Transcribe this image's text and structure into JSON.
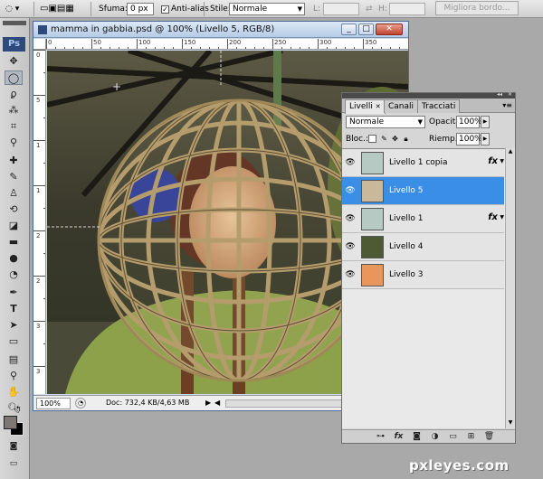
{
  "options_bar": {
    "feather_label": "Sfuma:",
    "feather_value": "0 px",
    "antialias_label": "Anti-alias",
    "antialias_checked": true,
    "style_label": "Stile:",
    "style_value": "Normale",
    "width_label": "L:",
    "height_label": "H:",
    "refine_edge_label": "Migliora bordo..."
  },
  "tools": {
    "logo": "Ps",
    "items": [
      "move-tool",
      "marquee-tool",
      "lasso-tool",
      "magic-wand-tool",
      "crop-tool",
      "eyedropper-tool",
      "healing-tool",
      "brush-tool",
      "clone-stamp-tool",
      "history-brush-tool",
      "eraser-tool",
      "gradient-tool",
      "blur-tool",
      "dodge-tool",
      "pen-tool",
      "type-tool",
      "path-selection-tool",
      "shape-tool",
      "notes-tool",
      "eyedropper-3d-tool",
      "hand-tool",
      "zoom-tool"
    ],
    "foreground_color": "#7f7774",
    "background_color": "#000000"
  },
  "document": {
    "title": "mamma in gabbia.psd @ 100% (Livello 5, RGB/8)",
    "zoom": "100%",
    "info": "Doc: 732,4 KB/4,63 MB",
    "ruler_top": [
      "0",
      "50",
      "100",
      "150",
      "200",
      "250",
      "300",
      "350"
    ],
    "ruler_left": [
      "0",
      "5",
      "1",
      "1",
      "2",
      "2",
      "3",
      "3"
    ]
  },
  "layers_panel": {
    "tabs": [
      "Livelli",
      "Canali",
      "Tracciati"
    ],
    "active_tab": "Livelli",
    "blend_mode": "Normale",
    "opacity_label": "Opacità:",
    "opacity_value": "100%",
    "lock_label": "Bloc.:",
    "fill_label": "Riemp.:",
    "fill_value": "100%",
    "layers": [
      {
        "name": "Livello 1 copia",
        "fx": "fx",
        "active": false,
        "thumb": "#b7c9c3"
      },
      {
        "name": "Livello 5",
        "fx": "",
        "active": true,
        "thumb": "#c9b89a"
      },
      {
        "name": "Livello 1",
        "fx": "fx",
        "active": false,
        "thumb": "#b7c9c3"
      },
      {
        "name": "Livello 4",
        "fx": "",
        "active": false,
        "thumb": "#4e5a34"
      },
      {
        "name": "Livello 3",
        "fx": "",
        "active": false,
        "thumb": "#e9955c"
      }
    ]
  },
  "watermark": "pxleyes.com"
}
